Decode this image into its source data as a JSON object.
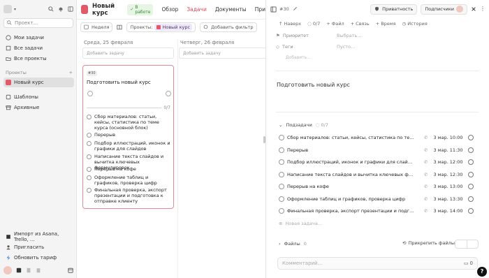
{
  "sidebar": {
    "search_placeholder": "Проект...",
    "items": [
      {
        "label": "Мои задачи"
      },
      {
        "label": "Все задачи"
      },
      {
        "label": "Все проекты"
      }
    ],
    "projects_header": "Проекты",
    "project": {
      "label": "Новый курс"
    },
    "templates": "Шаблоны",
    "archive": "Архивные",
    "import_label": "Импорт из Asana, Trello, ...",
    "invite_label": "Пригласить",
    "upgrade_label": "Обновить тариф"
  },
  "header": {
    "project_title": "Новый курс",
    "status_badge": "В работе",
    "tabs": [
      "Обзор",
      "Задачи",
      "Документы",
      "При"
    ]
  },
  "toolbar": {
    "week_label": "Неделя",
    "projects_label": "Проекты:",
    "project_chip": "Новый курс",
    "add_filter": "Добавить фильтр"
  },
  "columns": [
    {
      "date": "Среда, 25 февраля",
      "add_task": "Добавить задачу"
    },
    {
      "date": "Четверг, 26 февраля",
      "add_task": "Добавить задачу"
    }
  ],
  "card": {
    "id": "#30",
    "title": "Подготовить новый курс",
    "progress": "0/7",
    "subtasks": [
      "Сбор материалов: статьи, кейсы, статистика по теме курса (основной блок)",
      "Перерыв",
      "Подбор иллюстраций, иконок и графики для слайдов",
      "Написание текста слайдов и вычитка ключевых формулировок",
      "Перерыв на кофе",
      "Оформление таблиц и графиков, проверка цифр",
      "Финальная проверка, экспорт презентации и подготовка к отправке клиенту"
    ]
  },
  "panel": {
    "task_id": "#30",
    "privacy_label": "Приватность",
    "subscribers_label": "Подписчики",
    "actions": {
      "up": "Наверх",
      "progress": "0/7",
      "file": "Файл",
      "link": "Связь",
      "time": "Время",
      "history": "История"
    },
    "fields": [
      {
        "label": "Приоритет",
        "value": "Выбрать..."
      },
      {
        "label": "Теги",
        "value": "Пусто..."
      }
    ],
    "add_field": "Добавить...",
    "description": "Подготовить новый курс",
    "subtasks_header": "Подзадачи",
    "subtasks_count": "0/7",
    "subtasks": [
      {
        "title": "Сбор материалов: статьи, кейсы, статистика по теме ку...",
        "date": "3 мар. 10:00"
      },
      {
        "title": "Перерыв",
        "date": "3 мар. 11:30"
      },
      {
        "title": "Подбор иллюстраций, иконок и графики для слайдов",
        "date": "3 мар. 12:00"
      },
      {
        "title": "Написание текста слайдов и вычитка ключевых формул...",
        "date": "3 мар. 12:30"
      },
      {
        "title": "Перерыв на кофе",
        "date": "3 мар. 13:00"
      },
      {
        "title": "Оформление таблиц и графиков, проверка цифр",
        "date": "3 мар. 13:30"
      },
      {
        "title": "Финальная проверка, экспорт презентации и подготовк...",
        "date": "3 мар. 14:00"
      }
    ],
    "new_subtask": "Новая задача...",
    "files_label": "Файлы",
    "files_count": "0",
    "attach_files": "Прикрепить файлы",
    "comment_placeholder": "Комментарий...",
    "comment_count": "0",
    "help": "?"
  },
  "colors": {
    "accent": "#d94b5a",
    "project": "#e05a6a",
    "status_green": "#2f8a2f"
  }
}
